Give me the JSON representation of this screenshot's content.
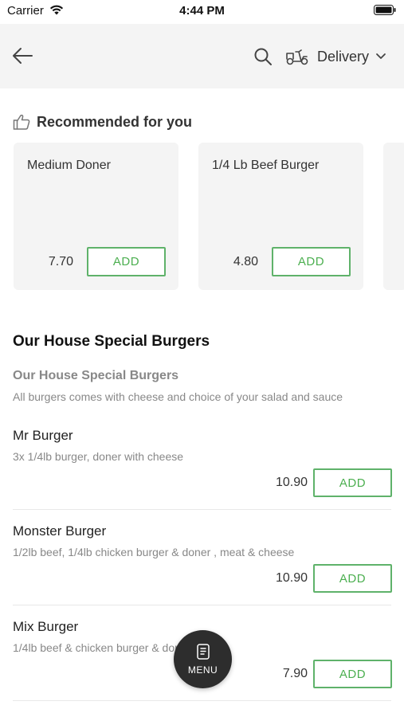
{
  "status_bar": {
    "carrier": "Carrier",
    "time": "4:44 PM"
  },
  "header": {
    "back_icon": "arrow-left-icon",
    "search_icon": "search-icon",
    "delivery_icon": "scooter-icon",
    "delivery_label": "Delivery",
    "chevron_icon": "chevron-down-icon"
  },
  "recommended": {
    "title": "Recommended for you",
    "icon": "thumbs-up-icon",
    "cards": [
      {
        "name": "Medium Doner",
        "price": "7.70",
        "add_label": "ADD"
      },
      {
        "name": "1/4 Lb Beef Burger",
        "price": "4.80",
        "add_label": "ADD"
      }
    ]
  },
  "section": {
    "title": "Our House Special Burgers",
    "category_title": "Our House Special Burgers",
    "category_description": "All burgers comes with cheese and choice of your salad and sauce"
  },
  "items": [
    {
      "name": "Mr Burger",
      "description": "3x 1/4lb burger, doner with cheese",
      "price": "10.90",
      "add_label": "ADD"
    },
    {
      "name": "Monster Burger",
      "description": "1/2lb beef, 1/4lb chicken burger & doner , meat & cheese",
      "price": "10.90",
      "add_label": "ADD"
    },
    {
      "name": "Mix Burger",
      "description": "1/4lb beef & chicken burger & doner",
      "price": "7.90",
      "add_label": "ADD"
    }
  ],
  "fab": {
    "label": "MENU",
    "icon": "menu-book-icon"
  },
  "colors": {
    "accent_green": "#5fb26a",
    "header_bg": "#f4f4f4",
    "fab_bg": "#2d2d2d"
  }
}
